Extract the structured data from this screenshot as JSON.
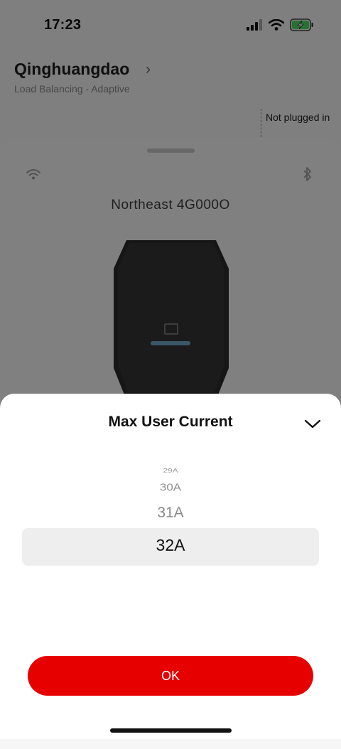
{
  "status_bar": {
    "time": "17:23"
  },
  "header": {
    "title": "Qinghuangdao",
    "subtitle": "Load Balancing - Adaptive",
    "plug_status": "Not plugged in"
  },
  "device": {
    "name": "Northeast 4G000O"
  },
  "sheet": {
    "title": "Max User Current",
    "options": [
      "29A",
      "30A",
      "31A",
      "32A"
    ],
    "selected": "32A",
    "ok_label": "OK"
  },
  "colors": {
    "accent": "#e60000",
    "selection_bg": "#eeeeef"
  },
  "icons": [
    "signal-icon",
    "wifi-icon",
    "battery-charging-icon",
    "chevron-right-icon",
    "wifi-icon",
    "bluetooth-icon",
    "chevron-down-icon"
  ]
}
